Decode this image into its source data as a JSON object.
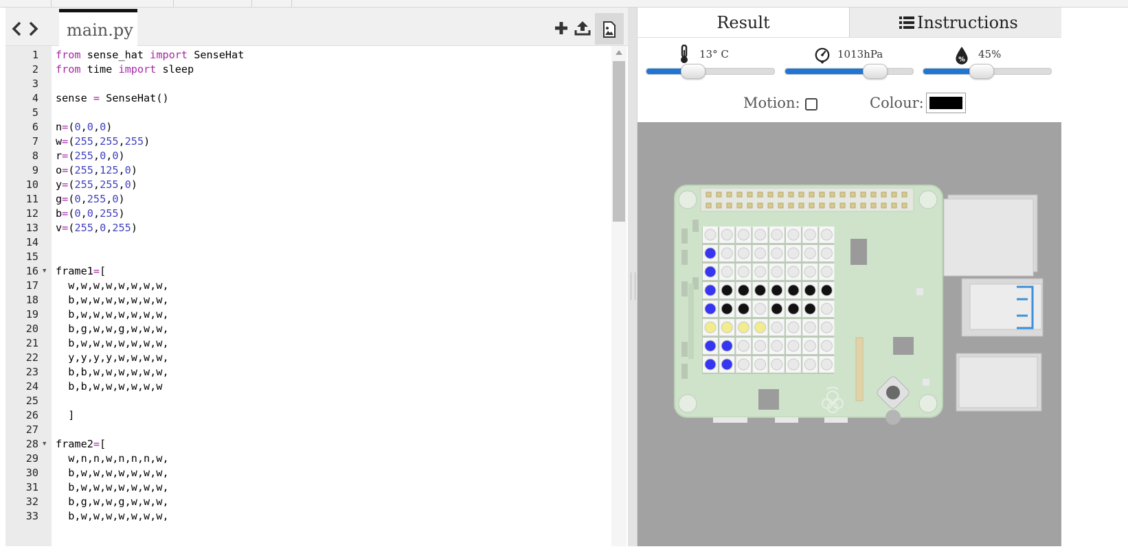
{
  "editor": {
    "file_tab": "main.py",
    "nav_icons": [
      "chevron-left-icon",
      "chevron-right-icon"
    ],
    "toolbar_icons": [
      "plus-icon",
      "upload-icon",
      "image-icon"
    ],
    "lines": [
      {
        "n": "1",
        "t": "from sense_hat import SenseHat"
      },
      {
        "n": "2",
        "t": "from time import sleep"
      },
      {
        "n": "3",
        "t": ""
      },
      {
        "n": "4",
        "t": "sense = SenseHat()"
      },
      {
        "n": "5",
        "t": ""
      },
      {
        "n": "6",
        "t": "n=(0,0,0)"
      },
      {
        "n": "7",
        "t": "w=(255,255,255)"
      },
      {
        "n": "8",
        "t": "r=(255,0,0)"
      },
      {
        "n": "9",
        "t": "o=(255,125,0)"
      },
      {
        "n": "10",
        "t": "y=(255,255,0)"
      },
      {
        "n": "11",
        "t": "g=(0,255,0)"
      },
      {
        "n": "12",
        "t": "b=(0,0,255)"
      },
      {
        "n": "13",
        "t": "v=(255,0,255)"
      },
      {
        "n": "14",
        "t": ""
      },
      {
        "n": "15",
        "t": ""
      },
      {
        "n": "16",
        "t": "frame1=[",
        "fold": true
      },
      {
        "n": "17",
        "t": "  w,w,w,w,w,w,w,w,"
      },
      {
        "n": "18",
        "t": "  b,w,w,w,w,w,w,w,"
      },
      {
        "n": "19",
        "t": "  b,w,w,w,w,w,w,w,"
      },
      {
        "n": "20",
        "t": "  b,g,w,w,g,w,w,w,"
      },
      {
        "n": "21",
        "t": "  b,w,w,w,w,w,w,w,"
      },
      {
        "n": "22",
        "t": "  y,y,y,y,w,w,w,w,"
      },
      {
        "n": "23",
        "t": "  b,b,w,w,w,w,w,w,"
      },
      {
        "n": "24",
        "t": "  b,b,w,w,w,w,w,w"
      },
      {
        "n": "25",
        "t": ""
      },
      {
        "n": "26",
        "t": "  ]"
      },
      {
        "n": "27",
        "t": ""
      },
      {
        "n": "28",
        "t": "frame2=[",
        "fold": true
      },
      {
        "n": "29",
        "t": "  w,n,n,w,n,n,n,w,"
      },
      {
        "n": "30",
        "t": "  b,w,w,w,w,w,w,w,"
      },
      {
        "n": "31",
        "t": "  b,w,w,w,w,w,w,w,"
      },
      {
        "n": "32",
        "t": "  b,g,w,w,g,w,w,w,"
      },
      {
        "n": "33",
        "t": "  b,w,w,w,w,w,w,w,"
      }
    ]
  },
  "right": {
    "tabs": {
      "result": "Result",
      "instructions": "Instructions"
    },
    "sensors": {
      "temperature": {
        "label": "13° C",
        "value_fraction": 0.36
      },
      "pressure": {
        "label": "1013hPa",
        "value_fraction": 0.7
      },
      "humidity": {
        "label": "45%",
        "value_fraction": 0.45
      }
    },
    "motion_label": "Motion:",
    "motion_checked": false,
    "colour_label": "Colour:",
    "colour_value": "#000000"
  },
  "led_matrix": [
    [
      "#e9e9e9",
      "#e9e9e9",
      "#e9e9e9",
      "#e9e9e9",
      "#e9e9e9",
      "#e9e9e9",
      "#e9e9e9",
      "#e9e9e9"
    ],
    [
      "#3636f0",
      "#e9e9e9",
      "#e9e9e9",
      "#e9e9e9",
      "#e9e9e9",
      "#e9e9e9",
      "#e9e9e9",
      "#e9e9e9"
    ],
    [
      "#3636f0",
      "#e9e9e9",
      "#e9e9e9",
      "#e9e9e9",
      "#e9e9e9",
      "#e9e9e9",
      "#e9e9e9",
      "#e9e9e9"
    ],
    [
      "#3636f0",
      "#111111",
      "#111111",
      "#111111",
      "#111111",
      "#111111",
      "#111111",
      "#111111"
    ],
    [
      "#3636f0",
      "#111111",
      "#111111",
      "#e9e9e9",
      "#111111",
      "#111111",
      "#111111",
      "#e9e9e9"
    ],
    [
      "#f1ec8c",
      "#f1ec8c",
      "#f1ec8c",
      "#f1ec8c",
      "#e9e9e9",
      "#e9e9e9",
      "#e9e9e9",
      "#e9e9e9"
    ],
    [
      "#3636f0",
      "#3636f0",
      "#e9e9e9",
      "#e9e9e9",
      "#e9e9e9",
      "#e9e9e9",
      "#e9e9e9",
      "#e9e9e9"
    ],
    [
      "#3636f0",
      "#3636f0",
      "#e9e9e9",
      "#e9e9e9",
      "#e9e9e9",
      "#e9e9e9",
      "#e9e9e9",
      "#e9e9e9"
    ]
  ],
  "colors": {
    "accent": "#1f76d3",
    "keyword": "#a626a4",
    "number": "#3f3fbf",
    "board": "#c9dfc6"
  }
}
